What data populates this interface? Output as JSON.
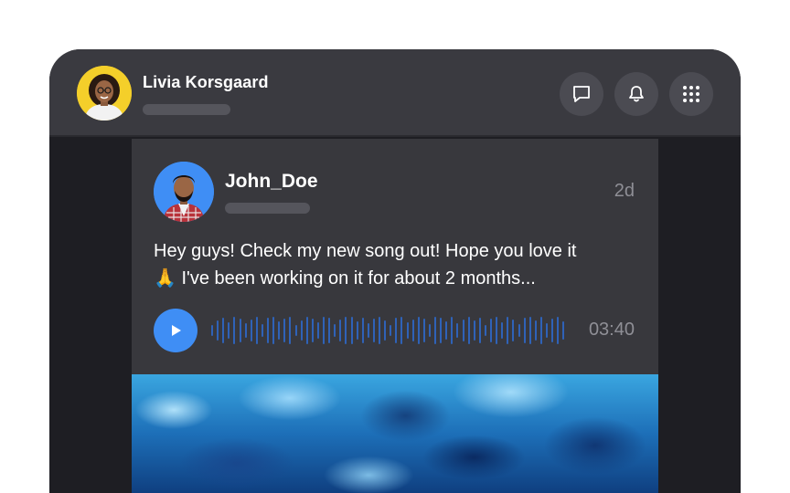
{
  "header": {
    "user_name": "Livia Korsgaard",
    "user_avatar_color": "#f4cf2a",
    "actions": [
      {
        "name": "chat-icon"
      },
      {
        "name": "bell-icon"
      },
      {
        "name": "apps-grid-icon"
      }
    ]
  },
  "post": {
    "author_name": "John_Doe",
    "author_avatar_color": "#3f8ef5",
    "time": "2d",
    "text_line1": "Hey guys! Check my new song out! Hope you love it",
    "text_line2": "🙏 I've been working on it for about 2 months...",
    "audio": {
      "duration": "03:40",
      "accent_color": "#3f8ef5"
    }
  },
  "colors": {
    "header_bg": "#3a3a40",
    "window_bg": "#1e1e23",
    "card_bg": "#38383d"
  }
}
